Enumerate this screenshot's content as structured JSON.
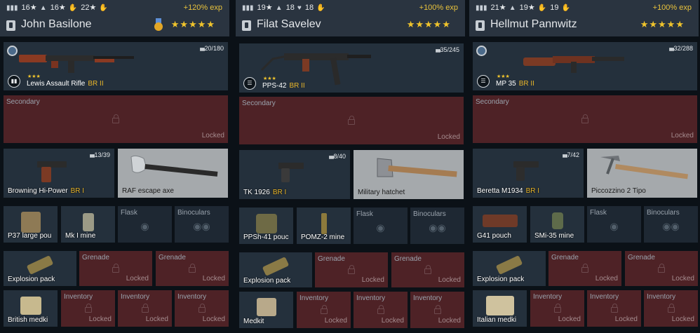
{
  "labels": {
    "secondary": "Secondary",
    "locked": "Locked",
    "grenade": "Grenade",
    "inventory": "Inventory",
    "flask": "Flask",
    "binoculars": "Binoculars"
  },
  "icons": {
    "star_rating": "five-star-rating",
    "stat1": "ammo-icon",
    "stat2": "soldier-icon",
    "stat3": "heart-icon",
    "stat4": "hand-icon"
  },
  "colors": {
    "accent": "#e8c23c",
    "locked_bg": "#4e2226",
    "panel_bg": "#24303c"
  },
  "soldiers": [
    {
      "stats": [
        "16★",
        "16★",
        "22★"
      ],
      "exp": "+120% exp",
      "name": "John Basilone",
      "stars": "★★★★★",
      "primary": {
        "name": "Lewis Assault Rifle",
        "br": "BR II",
        "ammo": "20/180",
        "weapon_stars": "★★★"
      },
      "pistol": {
        "name": "Browning Hi-Power",
        "br": "BR I",
        "ammo": "13/39"
      },
      "melee": {
        "name": "RAF escape axe"
      },
      "pouch": "P37 large pou",
      "mine": "Mk I mine",
      "explosive": "Explosion pack",
      "medkit": "British medki"
    },
    {
      "stats": [
        "19★",
        "18",
        "18"
      ],
      "exp": "+100% exp",
      "name": "Filat Savelev",
      "stars": "★★★★★",
      "primary": {
        "name": "PPS-42",
        "br": "BR II",
        "ammo": "35/245",
        "weapon_stars": "★★★"
      },
      "pistol": {
        "name": "TK 1926",
        "br": "BR I",
        "ammo": "8/40"
      },
      "melee": {
        "name": "Military hatchet"
      },
      "pouch": "PPSh-41 pouc",
      "mine": "POMZ-2 mine",
      "explosive": "Explosion pack",
      "medkit": "Medkit"
    },
    {
      "stats": [
        "21★",
        "19★",
        "19"
      ],
      "exp": "+100% exp",
      "name": "Hellmut Pannwitz",
      "stars": "★★★★★",
      "primary": {
        "name": "MP 35",
        "br": "BR II",
        "ammo": "32/288",
        "weapon_stars": "★★★"
      },
      "pistol": {
        "name": "Beretta M1934",
        "br": "BR I",
        "ammo": "7/42"
      },
      "melee": {
        "name": "Piccozzino 2 Tipo"
      },
      "pouch": "G41 pouch",
      "mine": "SMi-35 mine",
      "explosive": "Explosion pack",
      "medkit": "Italian medki"
    }
  ]
}
